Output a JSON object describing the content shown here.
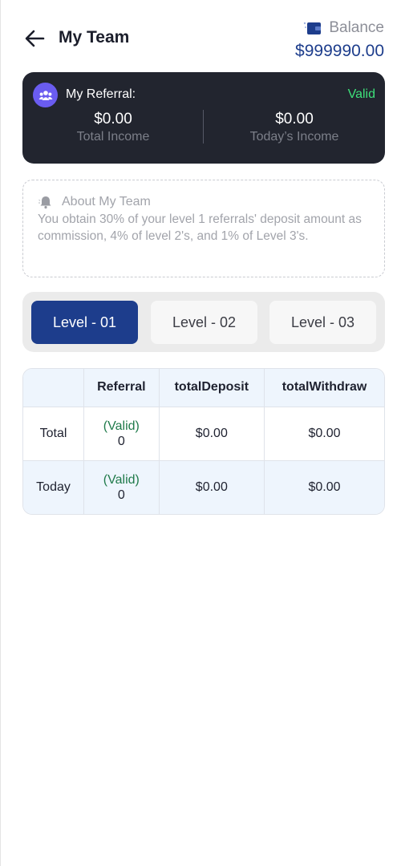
{
  "header": {
    "title": "My Team",
    "balance_label": "Balance",
    "balance_value": "$999990.00"
  },
  "referral_card": {
    "label": "My Referral:",
    "status": "Valid",
    "total_income_amount": "$0.00",
    "total_income_label": "Total Income",
    "today_income_amount": "$0.00",
    "today_income_label": "Today’s Income"
  },
  "about": {
    "title": "About My Team",
    "text": "You obtain 30% of your level 1 referrals' deposit amount as commission, 4% of level 2's, and 1% of Level 3's."
  },
  "tabs": [
    {
      "label": "Level - 01",
      "active": true
    },
    {
      "label": "Level - 02",
      "active": false
    },
    {
      "label": "Level - 03",
      "active": false
    }
  ],
  "table": {
    "headers": [
      "",
      "Referral",
      "totalDeposit",
      "totalWithdraw"
    ],
    "rows": [
      {
        "label": "Total",
        "valid": "(Valid)",
        "count": "0",
        "deposit": "$0.00",
        "withdraw": "$0.00"
      },
      {
        "label": "Today",
        "valid": "(Valid)",
        "count": "0",
        "deposit": "$0.00",
        "withdraw": "$0.00"
      }
    ]
  },
  "colors": {
    "brand_blue": "#1d3d8c",
    "card_dark": "#22252f",
    "valid_green": "#3ee07a",
    "table_valid_green": "#1f7a4a",
    "avatar_purple": "#6a5cf0"
  },
  "icons": {
    "back": "arrow-left-icon",
    "wallet": "wallet-icon",
    "avatar": "team-users-icon",
    "about": "bell-icon"
  }
}
